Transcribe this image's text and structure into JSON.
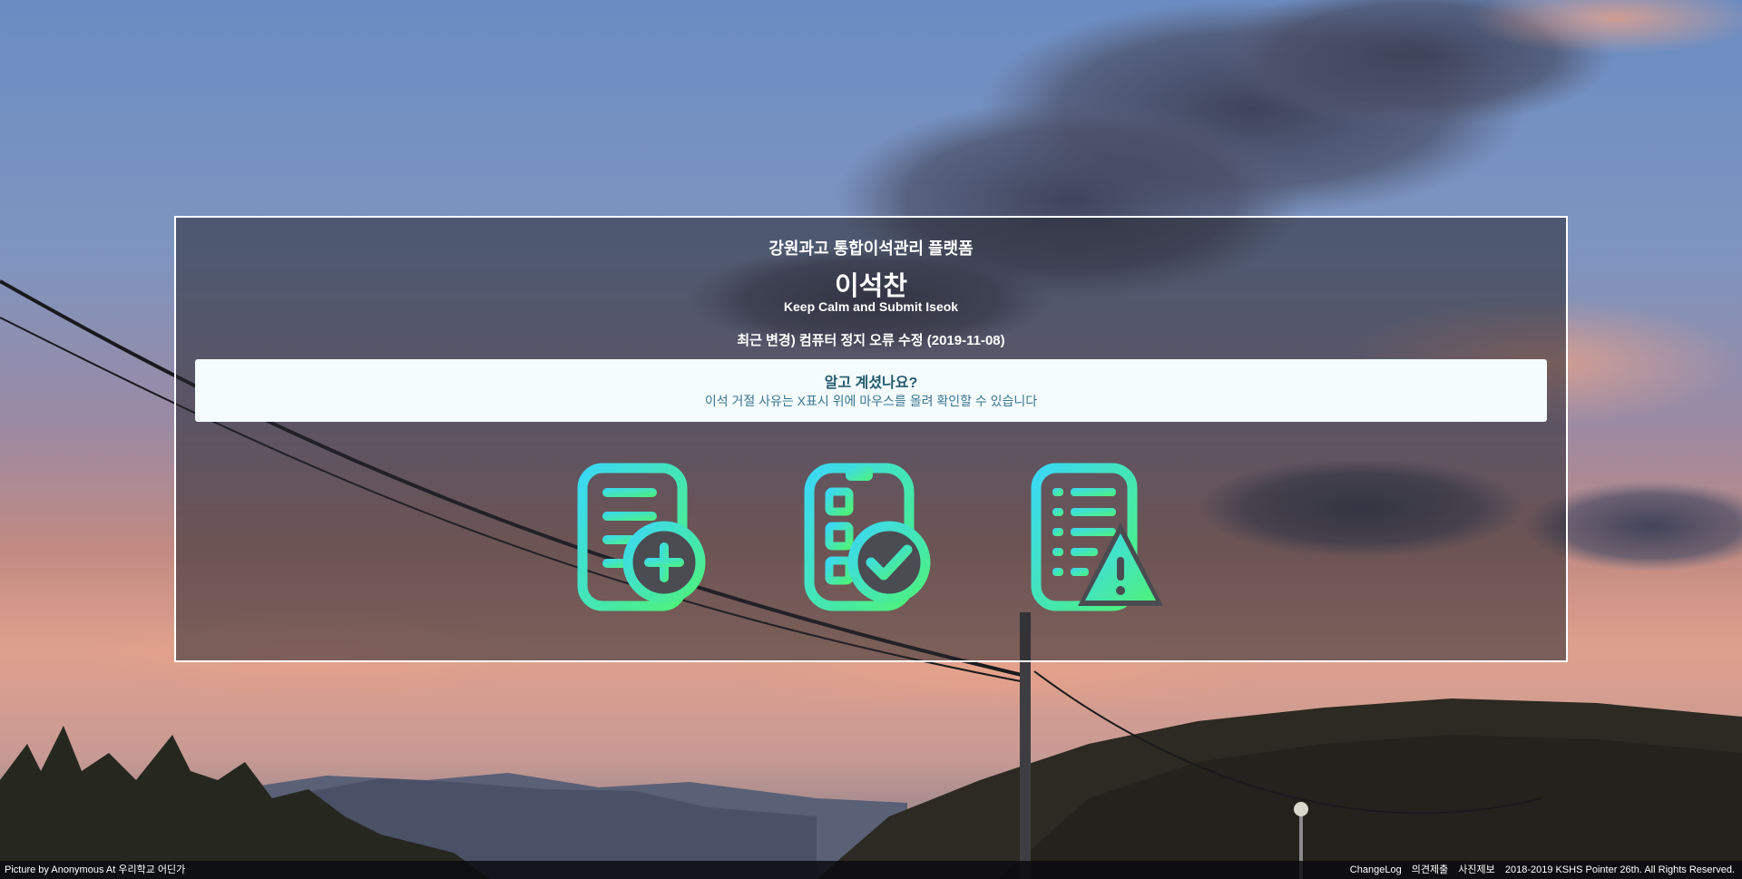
{
  "header": {
    "platform_title": "강원과고 통합이석관리 플랫폼",
    "app_name": "이석찬",
    "tagline": "Keep Calm and Submit Iseok",
    "recent_change": "최근 변경) 컴퓨터 정지 오류 수정 (2019-11-08)"
  },
  "notice": {
    "title": "알고 계셨나요?",
    "body": "이석 거절 사유는 X표시 위에 마우스를 올려 확인할 수 있습니다"
  },
  "actions": [
    {
      "icon": "document-add-icon"
    },
    {
      "icon": "clipboard-check-icon"
    },
    {
      "icon": "document-warning-icon"
    }
  ],
  "footer": {
    "credit": "Picture by Anonymous At 우리학교 어딘가",
    "changelog": "ChangeLog",
    "feedback": "의견제출",
    "photo_submit": "사진제보",
    "copyright": "2018-2019 KSHS Pointer 26th. All Rights Reserved."
  },
  "colors": {
    "icon_gradient_start": "#3ad8f5",
    "icon_gradient_end": "#4ef27a",
    "notice_background": "#f4fcfd",
    "notice_text": "#245a6e"
  }
}
